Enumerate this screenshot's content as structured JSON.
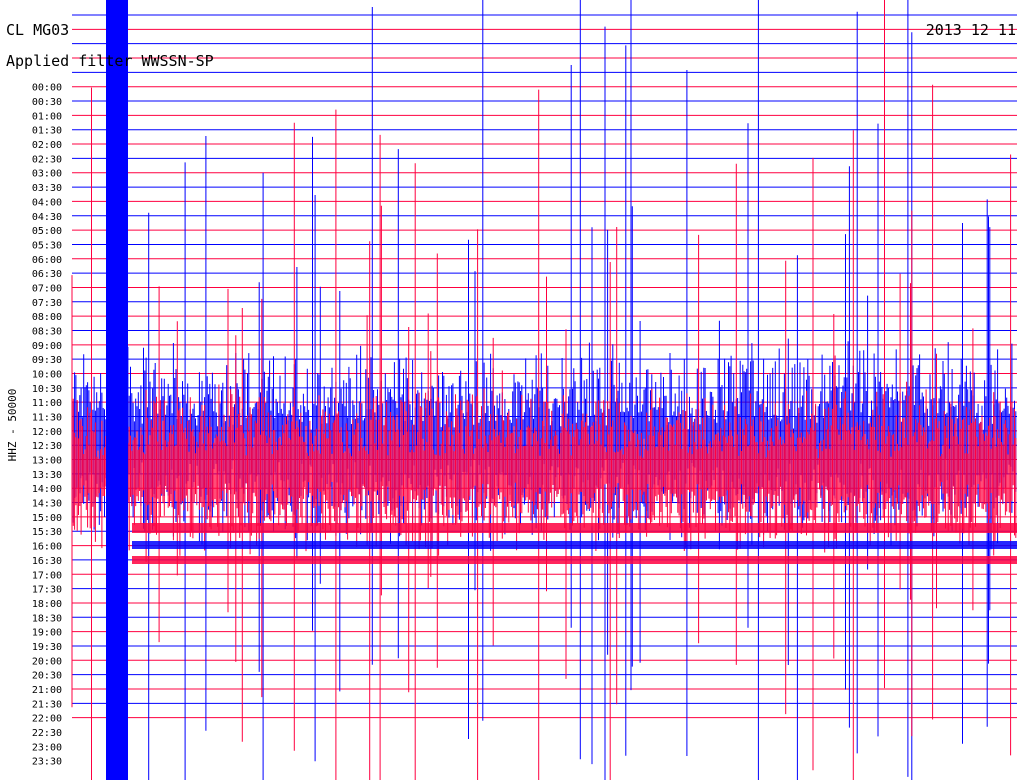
{
  "header": {
    "station": "CL MG03",
    "filter": "Applied filter WWSSN-SP",
    "date": "2013  12  11"
  },
  "chart_data": {
    "type": "line",
    "title": "CL MG03",
    "subtitle": "Applied filter WWSSN-SP",
    "ylabel": "HHZ - 50000",
    "rows": [
      "00:00",
      "00:30",
      "01:00",
      "01:30",
      "02:00",
      "02:30",
      "03:00",
      "03:30",
      "04:00",
      "04:30",
      "05:00",
      "05:30",
      "06:00",
      "06:30",
      "07:00",
      "07:30",
      "08:00",
      "08:30",
      "09:00",
      "09:30",
      "10:00",
      "10:30",
      "11:00",
      "11:30",
      "12:00",
      "12:30",
      "13:00",
      "13:30",
      "14:00",
      "14:30",
      "15:00",
      "15:30",
      "16:00",
      "16:30",
      "17:00",
      "17:30",
      "18:00",
      "18:30",
      "19:00",
      "19:30",
      "20:00",
      "20:30",
      "21:00",
      "21:30",
      "22:00",
      "22:30",
      "23:00",
      "23:30"
    ],
    "row_colors": [
      "#0000ff",
      "#ff0040"
    ],
    "grid": true,
    "series": [
      {
        "color": "#0000ff"
      },
      {
        "color": "#ff0040"
      }
    ]
  }
}
